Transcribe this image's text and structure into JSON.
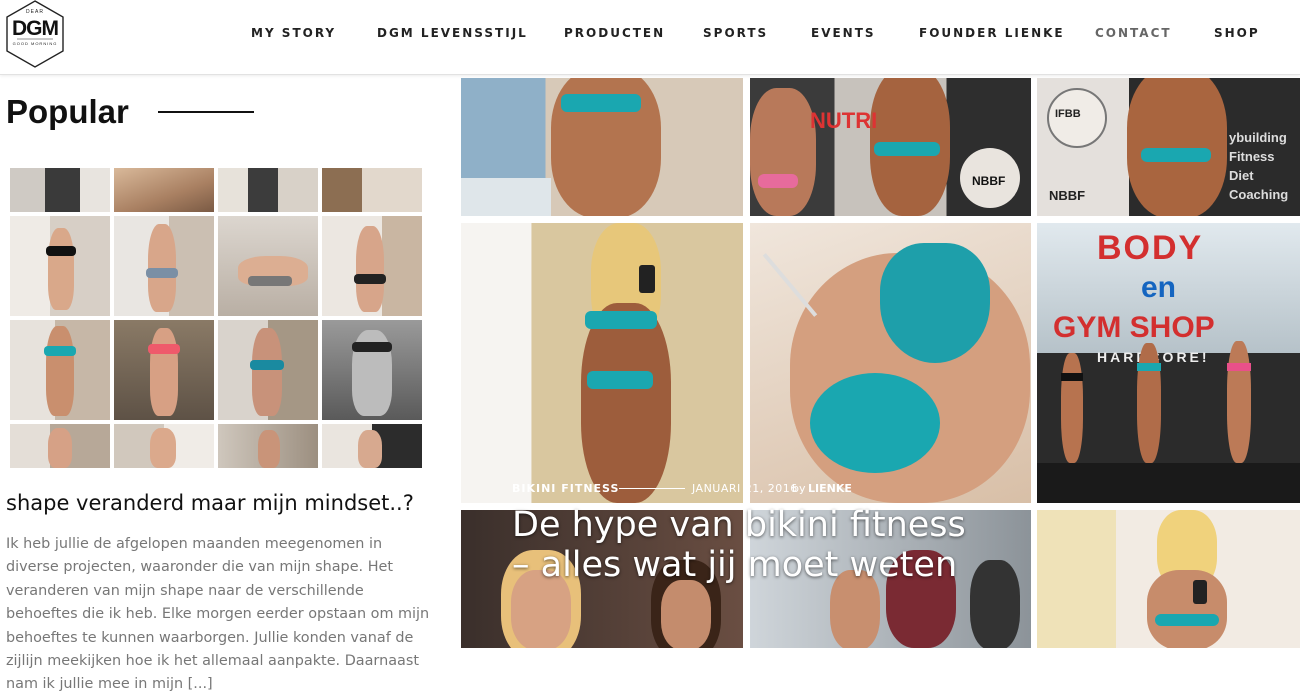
{
  "brand": {
    "logo_main": "DGM",
    "logo_top": "DEAR",
    "logo_sub": "GOOD MORNING"
  },
  "nav": {
    "items": [
      {
        "label": "MY STORY"
      },
      {
        "label": "DGM LEVENSSTIJL"
      },
      {
        "label": "PRODUCTEN"
      },
      {
        "label": "SPORTS"
      },
      {
        "label": "EVENTS"
      },
      {
        "label": "FOUNDER LIENKE"
      },
      {
        "label": "CONTACT"
      },
      {
        "label": "SHOP"
      }
    ]
  },
  "sidebar": {
    "heading": "Popular",
    "post_title": "shape veranderd maar mijn mindset..?",
    "post_excerpt": "Ik heb jullie de afgelopen maanden meegenomen in diverse projecten, waaronder die van mijn shape. Het veranderen van mijn shape naar de verschillende behoeftes die ik heb. Elke morgen eerder opstaan om mijn behoeftes te kunnen waarborgen. Jullie konden vanaf de zijlijn meekijken hoe ik het allemaal aanpakte. Daarnaast nam ik jullie mee in mijn [...]"
  },
  "featured": {
    "category": "BIKINI FITNESS",
    "date": "JANUARI 21, 2016",
    "by": "by",
    "author": "LIENKE",
    "title": "De hype van bikini fitness – alles wat jij moet weten"
  },
  "tile_text": {
    "poster_body": "BODY",
    "poster_en": "en",
    "poster_shop": "GYM SHOP",
    "poster_hardcore": "HARDCORE!",
    "banner_a": "NBBF",
    "banner_b": "NBBF",
    "banner_c": "IFBB",
    "banner_d": "ybuilding Fitness Diet Coaching",
    "banner_e": "NUTRI"
  },
  "colors": {
    "accent": "#1aa7b0",
    "text_dark": "#111111",
    "text_muted": "#777777"
  }
}
